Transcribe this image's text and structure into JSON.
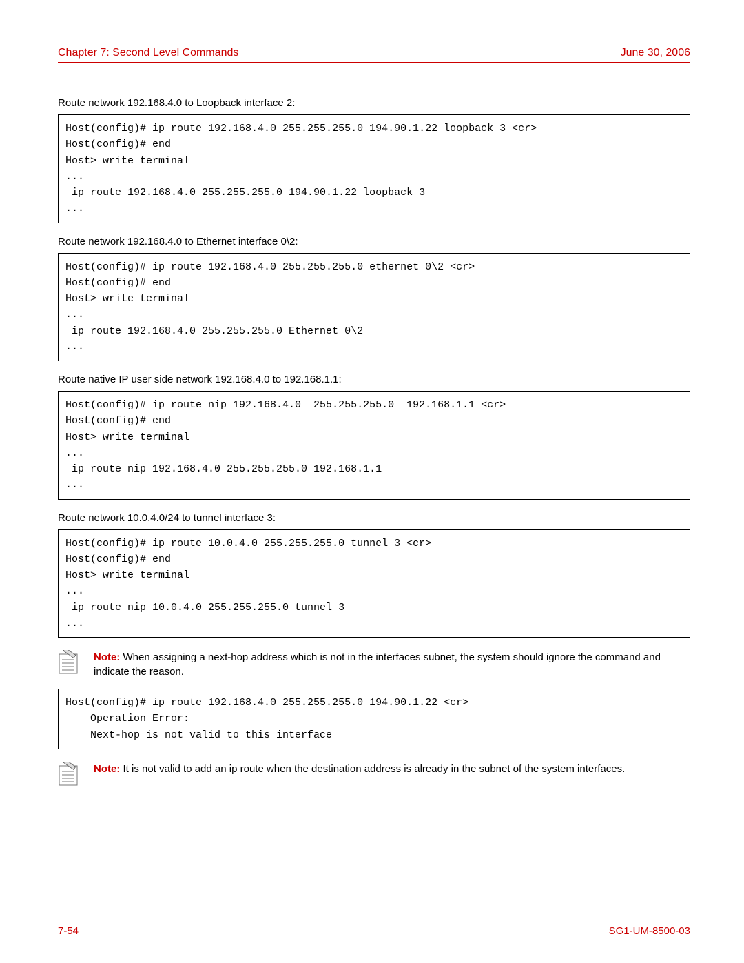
{
  "header": {
    "chapter": "Chapter 7: Second Level Commands",
    "date": "June 30, 2006"
  },
  "caption1": "Route network 192.168.4.0 to Loopback interface 2:",
  "code1": "Host(config)# ip route 192.168.4.0 255.255.255.0 194.90.1.22 loopback 3 <cr>\nHost(config)# end\nHost> write terminal\n...\n ip route 192.168.4.0 255.255.255.0 194.90.1.22 loopback 3\n...",
  "caption2": "Route network 192.168.4.0 to Ethernet interface 0\\2:",
  "code2": "Host(config)# ip route 192.168.4.0 255.255.255.0 ethernet 0\\2 <cr>\nHost(config)# end\nHost> write terminal\n...\n ip route 192.168.4.0 255.255.255.0 Ethernet 0\\2\n...",
  "caption3": "Route native IP user side network 192.168.4.0 to 192.168.1.1:",
  "code3": "Host(config)# ip route nip 192.168.4.0  255.255.255.0  192.168.1.1 <cr>\nHost(config)# end\nHost> write terminal\n...\n ip route nip 192.168.4.0 255.255.255.0 192.168.1.1\n...",
  "caption4": "Route network 10.0.4.0/24 to tunnel interface 3:",
  "code4": "Host(config)# ip route 10.0.4.0 255.255.255.0 tunnel 3 <cr>\nHost(config)# end\nHost> write terminal\n...\n ip route nip 10.0.4.0 255.255.255.0 tunnel 3\n...",
  "note1": {
    "label": "Note:",
    "text": " When assigning a next-hop address which is not in the interfaces subnet, the system should ignore the command and indicate the reason."
  },
  "code5": "Host(config)# ip route 192.168.4.0 255.255.255.0 194.90.1.22 <cr>\n    Operation Error:\n    Next-hop is not valid to this interface",
  "note2": {
    "label": "Note:",
    "text": " It is not valid to add an ip route when the destination address is already in the subnet of the system interfaces."
  },
  "footer": {
    "page": "7-54",
    "docnum": "SG1-UM-8500-03"
  }
}
